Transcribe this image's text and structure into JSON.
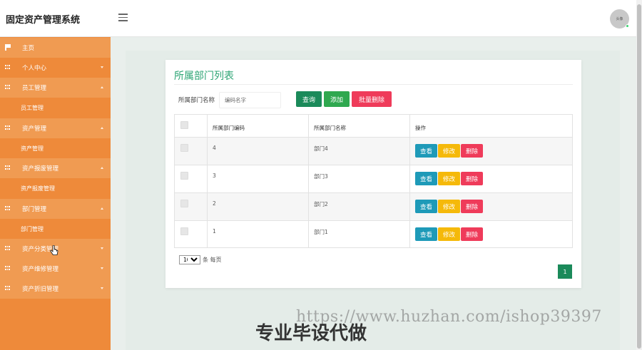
{
  "header": {
    "app_title": "固定资产管理系统",
    "avatar_text": "头像"
  },
  "sidebar": {
    "home": "主页",
    "personal_center": "个人中心",
    "employee_management": "员工管理",
    "employee_management_sub": "员工管理",
    "asset_management": "资产管理",
    "asset_management_sub": "资产管理",
    "asset_scrap_management": "资产报废管理",
    "asset_scrap_management_sub": "资产报废管理",
    "department_management": "部门管理",
    "department_management_sub": "部门管理",
    "asset_category_management": "资产分类管理",
    "asset_maintenance_management": "资产维修管理",
    "asset_depreciation_management": "资产折旧管理"
  },
  "main": {
    "title": "所属部门列表",
    "search_label": "所属部门名称",
    "search_placeholder": "编码名字",
    "btn_query": "查询",
    "btn_add": "添加",
    "btn_batch_delete": "批量删除"
  },
  "table": {
    "headers": {
      "code": "所属部门编码",
      "name": "所属部门名称",
      "actions": "操作"
    },
    "rows": [
      {
        "code": "4",
        "name": "部门4"
      },
      {
        "code": "3",
        "name": "部门3"
      },
      {
        "code": "2",
        "name": "部门2"
      },
      {
        "code": "1",
        "name": "部门1"
      }
    ],
    "action_view": "查看",
    "action_edit": "修改",
    "action_delete": "删除"
  },
  "pagination": {
    "page_size": "10",
    "page_size_options": [
      "10"
    ],
    "per_page_label": "条 每页",
    "current_page": "1"
  },
  "watermark": {
    "url": "https://www.huzhan.com/ishop39397",
    "slogan": "专业毕设代做"
  }
}
